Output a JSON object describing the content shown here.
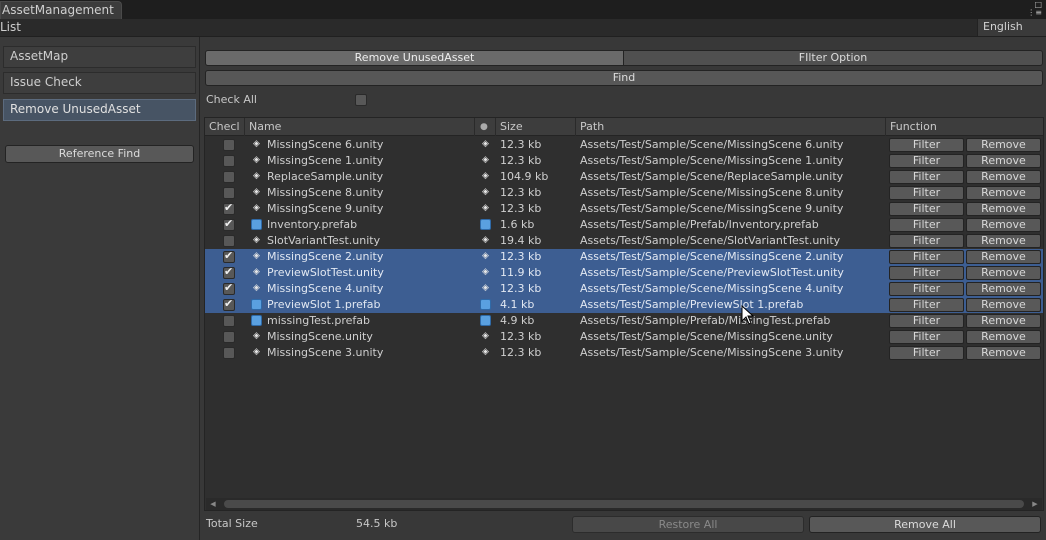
{
  "window": {
    "title": "AssetManagement"
  },
  "menubar": {
    "list": "List",
    "language": "English"
  },
  "sidebar": {
    "items": [
      {
        "label": "AssetMap",
        "active": false
      },
      {
        "label": "Issue Check",
        "active": false
      },
      {
        "label": "Remove UnusedAsset",
        "active": true
      }
    ],
    "reference_find": "Reference Find"
  },
  "tabs": {
    "remove": "Remove UnusedAsset",
    "filter": "FIlter Option"
  },
  "find_label": "Find",
  "check_all_label": "Check All",
  "check_all_checked": false,
  "columns": {
    "check": "Checl",
    "name": "Name",
    "size": "Size",
    "path": "Path",
    "function": "Function"
  },
  "buttons": {
    "filter": "Filter",
    "remove": "Remove"
  },
  "rows": [
    {
      "checked": false,
      "selected": false,
      "type": "unity",
      "name": "MissingScene 6.unity",
      "size": "12.3 kb",
      "path": "Assets/Test/Sample/Scene/MissingScene 6.unity"
    },
    {
      "checked": false,
      "selected": false,
      "type": "unity",
      "name": "MissingScene 1.unity",
      "size": "12.3 kb",
      "path": "Assets/Test/Sample/Scene/MissingScene 1.unity"
    },
    {
      "checked": false,
      "selected": false,
      "type": "unity",
      "name": "ReplaceSample.unity",
      "size": "104.9 kb",
      "path": "Assets/Test/Sample/Scene/ReplaceSample.unity"
    },
    {
      "checked": false,
      "selected": false,
      "type": "unity",
      "name": "MissingScene 8.unity",
      "size": "12.3 kb",
      "path": "Assets/Test/Sample/Scene/MissingScene 8.unity"
    },
    {
      "checked": true,
      "selected": false,
      "type": "unity",
      "name": "MissingScene 9.unity",
      "size": "12.3 kb",
      "path": "Assets/Test/Sample/Scene/MissingScene 9.unity"
    },
    {
      "checked": true,
      "selected": false,
      "type": "prefab",
      "name": "Inventory.prefab",
      "size": "1.6 kb",
      "path": "Assets/Test/Sample/Prefab/Inventory.prefab"
    },
    {
      "checked": false,
      "selected": false,
      "type": "unity",
      "name": "SlotVariantTest.unity",
      "size": "19.4 kb",
      "path": "Assets/Test/Sample/Scene/SlotVariantTest.unity"
    },
    {
      "checked": true,
      "selected": true,
      "type": "unity",
      "name": "MissingScene 2.unity",
      "size": "12.3 kb",
      "path": "Assets/Test/Sample/Scene/MissingScene 2.unity"
    },
    {
      "checked": true,
      "selected": true,
      "type": "unity",
      "name": "PreviewSlotTest.unity",
      "size": "11.9 kb",
      "path": "Assets/Test/Sample/Scene/PreviewSlotTest.unity"
    },
    {
      "checked": true,
      "selected": true,
      "type": "unity",
      "name": "MissingScene 4.unity",
      "size": "12.3 kb",
      "path": "Assets/Test/Sample/Scene/MissingScene 4.unity"
    },
    {
      "checked": true,
      "selected": true,
      "type": "prefab",
      "name": "PreviewSlot 1.prefab",
      "size": "4.1 kb",
      "path": "Assets/Test/Sample/PreviewSlot 1.prefab"
    },
    {
      "checked": false,
      "selected": false,
      "type": "prefab",
      "name": "missingTest.prefab",
      "size": "4.9 kb",
      "path": "Assets/Test/Sample/Prefab/MissingTest.prefab"
    },
    {
      "checked": false,
      "selected": false,
      "type": "unity",
      "name": "MissingScene.unity",
      "size": "12.3 kb",
      "path": "Assets/Test/Sample/Scene/MissingScene.unity"
    },
    {
      "checked": false,
      "selected": false,
      "type": "unity",
      "name": "MissingScene 3.unity",
      "size": "12.3 kb",
      "path": "Assets/Test/Sample/Scene/MissingScene 3.unity"
    }
  ],
  "footer": {
    "total_size_label": "Total Size",
    "total_size_value": "54.5 kb",
    "restore_all": "Restore All",
    "remove_all": "Remove All"
  },
  "colors": {
    "selection": "#3d5e92",
    "prefab_icon": "#5aa0e0",
    "background": "#383838"
  },
  "icons": {
    "unity": "unity-scene-icon",
    "prefab": "prefab-cube-icon"
  }
}
